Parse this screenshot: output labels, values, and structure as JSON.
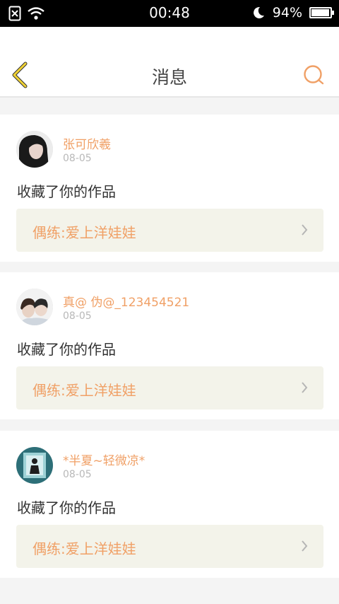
{
  "status_bar": {
    "time": "00:48",
    "battery": "94%"
  },
  "header": {
    "title": "消息"
  },
  "messages": [
    {
      "user": "张可欣羲",
      "date": "08-05",
      "action": "收藏了你的作品",
      "work": "偶练:爱上洋娃娃"
    },
    {
      "user": "真@ 伪@_123454521",
      "date": "08-05",
      "action": "收藏了你的作品",
      "work": "偶练:爱上洋娃娃"
    },
    {
      "user": "*半夏~轻微凉*",
      "date": "08-05",
      "action": "收藏了你的作品",
      "work": "偶练:爱上洋娃娃"
    }
  ],
  "colors": {
    "accent": "#f0a066",
    "back_arrow": "#f1d334",
    "work_bg": "#f3f3ea"
  }
}
